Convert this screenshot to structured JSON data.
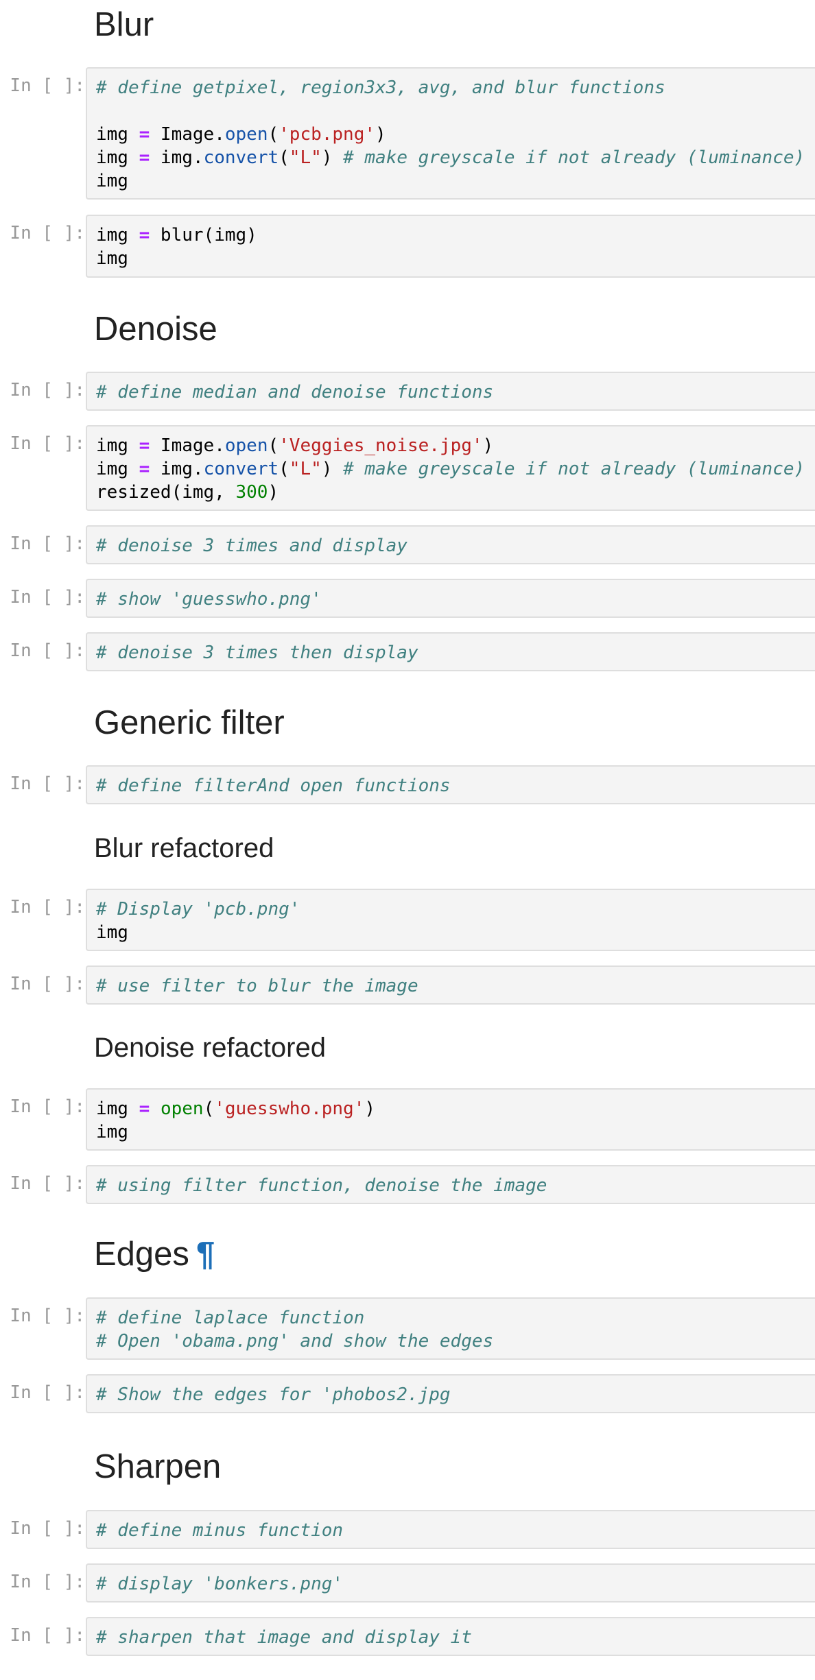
{
  "prompt_label": "In [ ]:",
  "pilcrow": "¶",
  "sections": [
    {
      "title": "Blur",
      "level": "h2"
    },
    {
      "title": "Denoise",
      "level": "h2"
    },
    {
      "title": "Generic filter",
      "level": "h2"
    },
    {
      "title": "Blur refactored",
      "level": "h3"
    },
    {
      "title": "Denoise refactored",
      "level": "h3"
    },
    {
      "title": "Edges",
      "level": "h2"
    },
    {
      "title": "Sharpen",
      "level": "h2"
    }
  ],
  "cells": [
    {
      "lines": [
        [
          [
            "comment",
            "# define getpixel, region3x3, avg, and blur functions"
          ]
        ],
        [],
        [
          [
            "text",
            "img "
          ],
          [
            "op",
            "="
          ],
          [
            "text",
            " Image."
          ],
          [
            "attr",
            "open"
          ],
          [
            "text",
            "("
          ],
          [
            "str",
            "'pcb.png'"
          ],
          [
            "text",
            ")"
          ]
        ],
        [
          [
            "text",
            "img "
          ],
          [
            "op",
            "="
          ],
          [
            "text",
            " img."
          ],
          [
            "attr",
            "convert"
          ],
          [
            "text",
            "("
          ],
          [
            "str",
            "\"L\""
          ],
          [
            "text",
            ") "
          ],
          [
            "comment",
            "# make greyscale if not already (luminance)"
          ]
        ],
        [
          [
            "text",
            "img"
          ]
        ]
      ]
    },
    {
      "lines": [
        [
          [
            "text",
            "img "
          ],
          [
            "op",
            "="
          ],
          [
            "text",
            " blur(img)"
          ]
        ],
        [
          [
            "text",
            "img"
          ]
        ]
      ]
    },
    {
      "lines": [
        [
          [
            "comment",
            "# define median and denoise functions"
          ]
        ]
      ]
    },
    {
      "lines": [
        [
          [
            "text",
            "img "
          ],
          [
            "op",
            "="
          ],
          [
            "text",
            " Image."
          ],
          [
            "attr",
            "open"
          ],
          [
            "text",
            "("
          ],
          [
            "str",
            "'Veggies_noise.jpg'"
          ],
          [
            "text",
            ")"
          ]
        ],
        [
          [
            "text",
            "img "
          ],
          [
            "op",
            "="
          ],
          [
            "text",
            " img."
          ],
          [
            "attr",
            "convert"
          ],
          [
            "text",
            "("
          ],
          [
            "str",
            "\"L\""
          ],
          [
            "text",
            ") "
          ],
          [
            "comment",
            "# make greyscale if not already (luminance)"
          ]
        ],
        [
          [
            "text",
            "resized(img, "
          ],
          [
            "num",
            "300"
          ],
          [
            "text",
            ")"
          ]
        ]
      ]
    },
    {
      "lines": [
        [
          [
            "comment",
            "# denoise 3 times and display"
          ]
        ]
      ]
    },
    {
      "lines": [
        [
          [
            "comment",
            "# show 'guesswho.png'"
          ]
        ]
      ]
    },
    {
      "lines": [
        [
          [
            "comment",
            "# denoise 3 times then display"
          ]
        ]
      ]
    },
    {
      "lines": [
        [
          [
            "comment",
            "# define filterAnd open functions"
          ]
        ]
      ]
    },
    {
      "lines": [
        [
          [
            "comment",
            "# Display 'pcb.png'"
          ]
        ],
        [
          [
            "text",
            "img"
          ]
        ]
      ]
    },
    {
      "lines": [
        [
          [
            "comment",
            "# use filter to blur the image"
          ]
        ]
      ]
    },
    {
      "lines": [
        [
          [
            "text",
            "img "
          ],
          [
            "op",
            "="
          ],
          [
            "text",
            " "
          ],
          [
            "builtin",
            "open"
          ],
          [
            "text",
            "("
          ],
          [
            "str",
            "'guesswho.png'"
          ],
          [
            "text",
            ")"
          ]
        ],
        [
          [
            "text",
            "img"
          ]
        ]
      ]
    },
    {
      "lines": [
        [
          [
            "comment",
            "# using filter function, denoise the image"
          ]
        ]
      ]
    },
    {
      "lines": [
        [
          [
            "comment",
            "# define laplace function"
          ]
        ],
        [
          [
            "comment",
            "# Open 'obama.png' and show the edges"
          ]
        ]
      ]
    },
    {
      "lines": [
        [
          [
            "comment",
            "# Show the edges for 'phobos2.jpg"
          ]
        ]
      ]
    },
    {
      "lines": [
        [
          [
            "comment",
            "# define minus function"
          ]
        ]
      ]
    },
    {
      "lines": [
        [
          [
            "comment",
            "# display 'bonkers.png'"
          ]
        ]
      ]
    },
    {
      "lines": [
        [
          [
            "comment",
            "# sharpen that image and display it"
          ]
        ]
      ]
    }
  ],
  "colors": {
    "comment": "#408080",
    "operator": "#aa22ff",
    "attribute": "#1552a8",
    "builtin": "#008000",
    "string": "#ba2121",
    "number": "#008000",
    "prompt": "#999999",
    "cell_background": "#f4f4f4",
    "cell_border": "#dedede",
    "anchor": "#1d6fb8"
  }
}
